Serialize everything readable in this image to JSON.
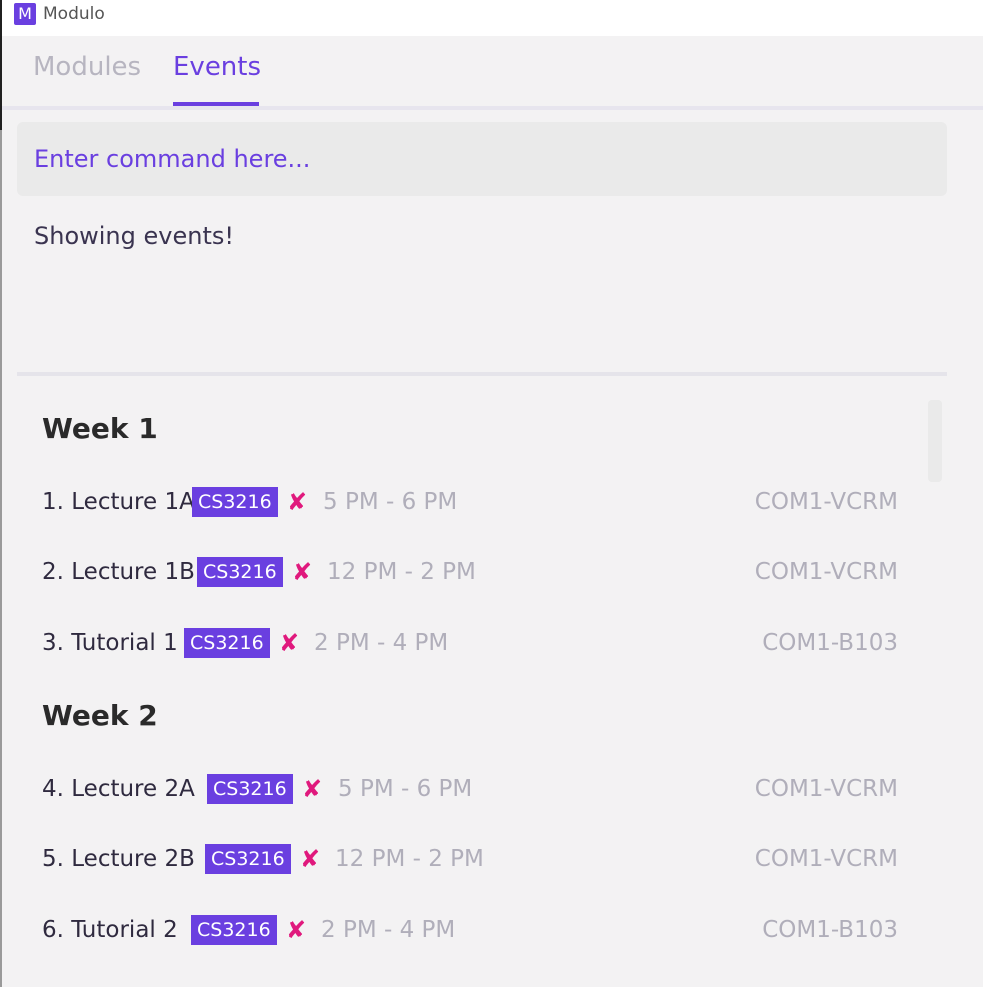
{
  "window": {
    "app_icon_letter": "M",
    "title": "Modulo"
  },
  "tabs": [
    {
      "label": "Modules",
      "active": false
    },
    {
      "label": "Events",
      "active": true
    }
  ],
  "command": {
    "placeholder": "Enter command here..."
  },
  "result": {
    "message": "Showing events!"
  },
  "weeks": [
    {
      "title": "Week 1",
      "events": [
        {
          "name": "1. Lecture 1A",
          "module": "CS3216",
          "status_icon": "cross-icon",
          "time": "5 PM - 6 PM",
          "location": "COM1-VCRM"
        },
        {
          "name": "2. Lecture 1B",
          "module": "CS3216",
          "status_icon": "cross-icon",
          "time": "12 PM - 2 PM",
          "location": "COM1-VCRM"
        },
        {
          "name": "3. Tutorial 1",
          "module": "CS3216",
          "status_icon": "cross-icon",
          "time": "2 PM - 4 PM",
          "location": "COM1-B103"
        }
      ]
    },
    {
      "title": "Week 2",
      "events": [
        {
          "name": "4. Lecture 2A",
          "module": "CS3216",
          "status_icon": "cross-icon",
          "time": "5 PM - 6 PM",
          "location": "COM1-VCRM"
        },
        {
          "name": "5. Lecture 2B",
          "module": "CS3216",
          "status_icon": "cross-icon",
          "time": "12 PM - 2 PM",
          "location": "COM1-VCRM"
        },
        {
          "name": "6. Tutorial 2",
          "module": "CS3216",
          "status_icon": "cross-icon",
          "time": "2 PM - 4 PM",
          "location": "COM1-B103"
        }
      ]
    }
  ],
  "colors": {
    "accent": "#6a3fe0",
    "status_cross": "#e0197d",
    "muted_text": "#b0aeba",
    "background": "#f3f2f3"
  }
}
